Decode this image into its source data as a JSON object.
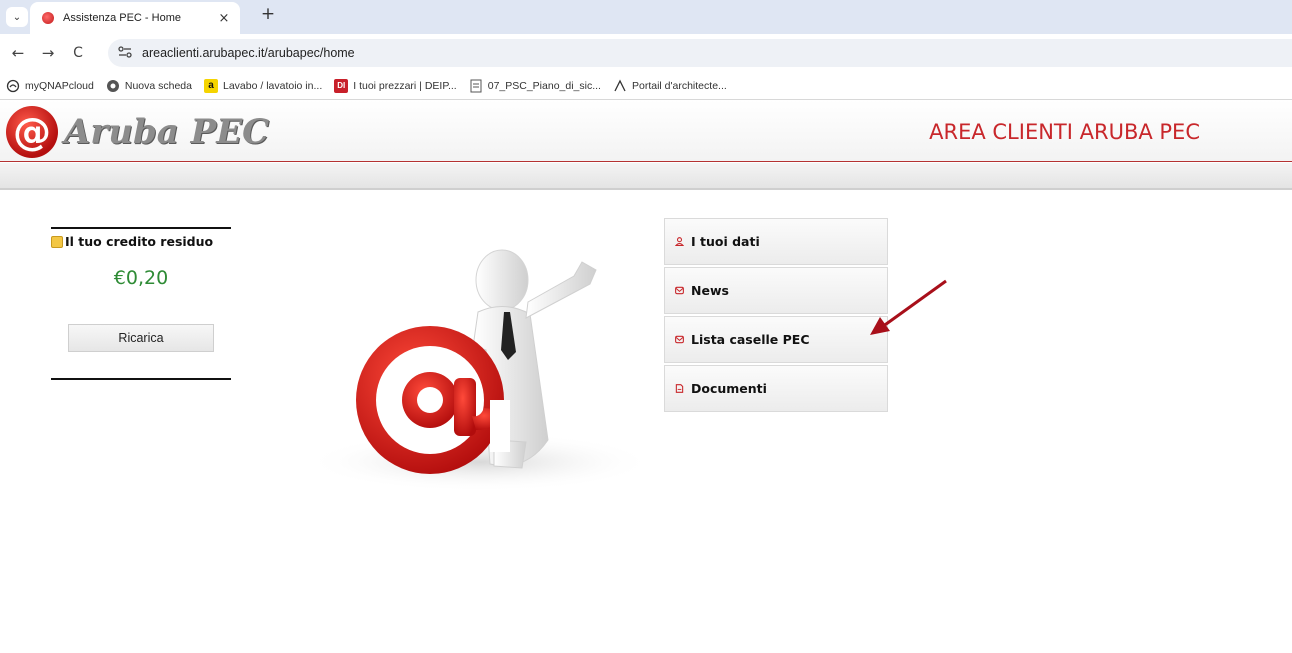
{
  "browser": {
    "tab": {
      "title": "Assistenza PEC - Home",
      "close": "×"
    },
    "new_tab": "+",
    "dropdown": "⌄",
    "nav": {
      "back": "←",
      "forward": "→",
      "reload": "C"
    },
    "url": "areaclienti.arubapec.it/arubapec/home",
    "bookmarks": [
      {
        "label": "myQNAPcloud",
        "icon": "cloud-icon"
      },
      {
        "label": "Nuova scheda",
        "icon": "chrome-icon"
      },
      {
        "label": "Lavabo / lavatoio in...",
        "icon": "amazon-icon"
      },
      {
        "label": "I tuoi prezzari | DEIP...",
        "icon": "dei-icon"
      },
      {
        "label": "07_PSC_Piano_di_sic...",
        "icon": "document-icon"
      },
      {
        "label": "Portail d'architecte...",
        "icon": "caret-icon"
      }
    ]
  },
  "header": {
    "logo_text": "Aruba PEC",
    "logo_symbol": "@",
    "area_title": "AREA CLIENTI ARUBA PEC",
    "brand_color": "#c8272b"
  },
  "credit": {
    "heading": "Il tuo credito residuo",
    "value": "€0,20",
    "recharge_label": "Ricarica",
    "value_color": "#2e8b35"
  },
  "menu": {
    "items": [
      {
        "label": "I tuoi dati",
        "icon": "user-icon"
      },
      {
        "label": "News",
        "icon": "mail-icon"
      },
      {
        "label": "Lista caselle PEC",
        "icon": "mail-icon"
      },
      {
        "label": "Documenti",
        "icon": "document-icon"
      }
    ]
  }
}
